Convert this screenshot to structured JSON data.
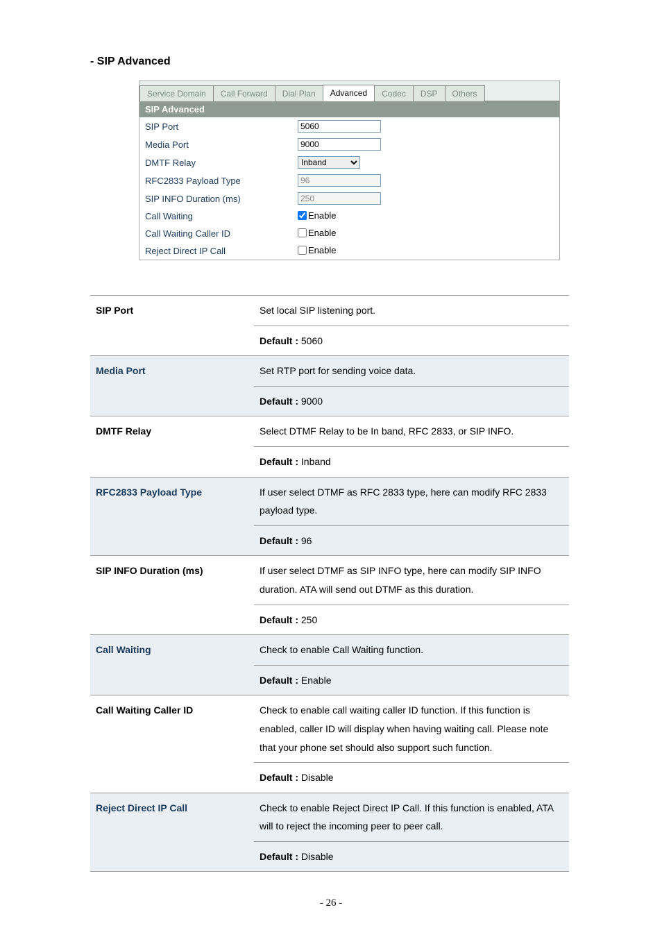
{
  "section_title": "- SIP Advanced",
  "tabs": {
    "service_domain": "Service Domain",
    "call_forward": "Call Forward",
    "dial_plan": "Dial Plan",
    "advanced": "Advanced",
    "codec": "Codec",
    "dsp": "DSP",
    "others": "Others"
  },
  "panel_header": "SIP Advanced",
  "form": {
    "sip_port": {
      "label": "SIP Port",
      "value": "5060"
    },
    "media_port": {
      "label": "Media Port",
      "value": "9000"
    },
    "dmtf_relay": {
      "label": "DMTF Relay",
      "value": "Inband"
    },
    "rfc2833": {
      "label": "RFC2833 Payload Type",
      "value": "96"
    },
    "sip_info_dur": {
      "label": "SIP INFO Duration (ms)",
      "value": "250"
    },
    "call_waiting": {
      "label": "Call Waiting",
      "enable_text": "Enable",
      "checked": true
    },
    "cw_caller_id": {
      "label": "Call Waiting Caller ID",
      "enable_text": "Enable",
      "checked": false
    },
    "reject_direct_ip": {
      "label": "Reject Direct IP Call",
      "enable_text": "Enable",
      "checked": false
    }
  },
  "desc": {
    "sip_port": {
      "name": "SIP Port",
      "text": "Set local SIP listening port.",
      "default_label": "Default :",
      "default_value": " 5060"
    },
    "media_port": {
      "name": "Media Port",
      "text": "Set RTP port for sending voice data.",
      "default_label": "Default :",
      "default_value": " 9000"
    },
    "dmtf_relay": {
      "name": "DMTF Relay",
      "text": "Select DTMF Relay to be In band, RFC 2833, or SIP INFO.",
      "default_label": "Default :",
      "default_value": " Inband"
    },
    "rfc2833": {
      "name": "RFC2833 Payload Type",
      "text": "If user select DTMF as RFC 2833 type, here can modify RFC 2833 payload type.",
      "default_label": "Default :",
      "default_value": " 96"
    },
    "sip_info_dur": {
      "name": "SIP INFO Duration (ms)",
      "text": "If user select DTMF as SIP INFO type, here can modify SIP INFO duration. ATA will send out DTMF as this duration.",
      "default_label": "Default :",
      "default_value": " 250"
    },
    "call_waiting": {
      "name": "Call Waiting",
      "text": "Check to enable Call Waiting function.",
      "default_label": "Default :",
      "default_value": " Enable"
    },
    "cw_caller_id": {
      "name": "Call Waiting Caller ID",
      "text": "Check to enable call waiting caller ID function. If this function is enabled, caller ID will display when having waiting call. Please note that your phone set should also support such function.",
      "default_label": "Default :",
      "default_value": " Disable"
    },
    "reject_direct_ip": {
      "name": "Reject Direct IP Call",
      "text": "Check to enable Reject Direct IP Call. If this function is enabled, ATA will to reject the incoming peer to peer call.",
      "default_label": "Default :",
      "default_value": " Disable"
    }
  },
  "page_number": "- 26 -"
}
